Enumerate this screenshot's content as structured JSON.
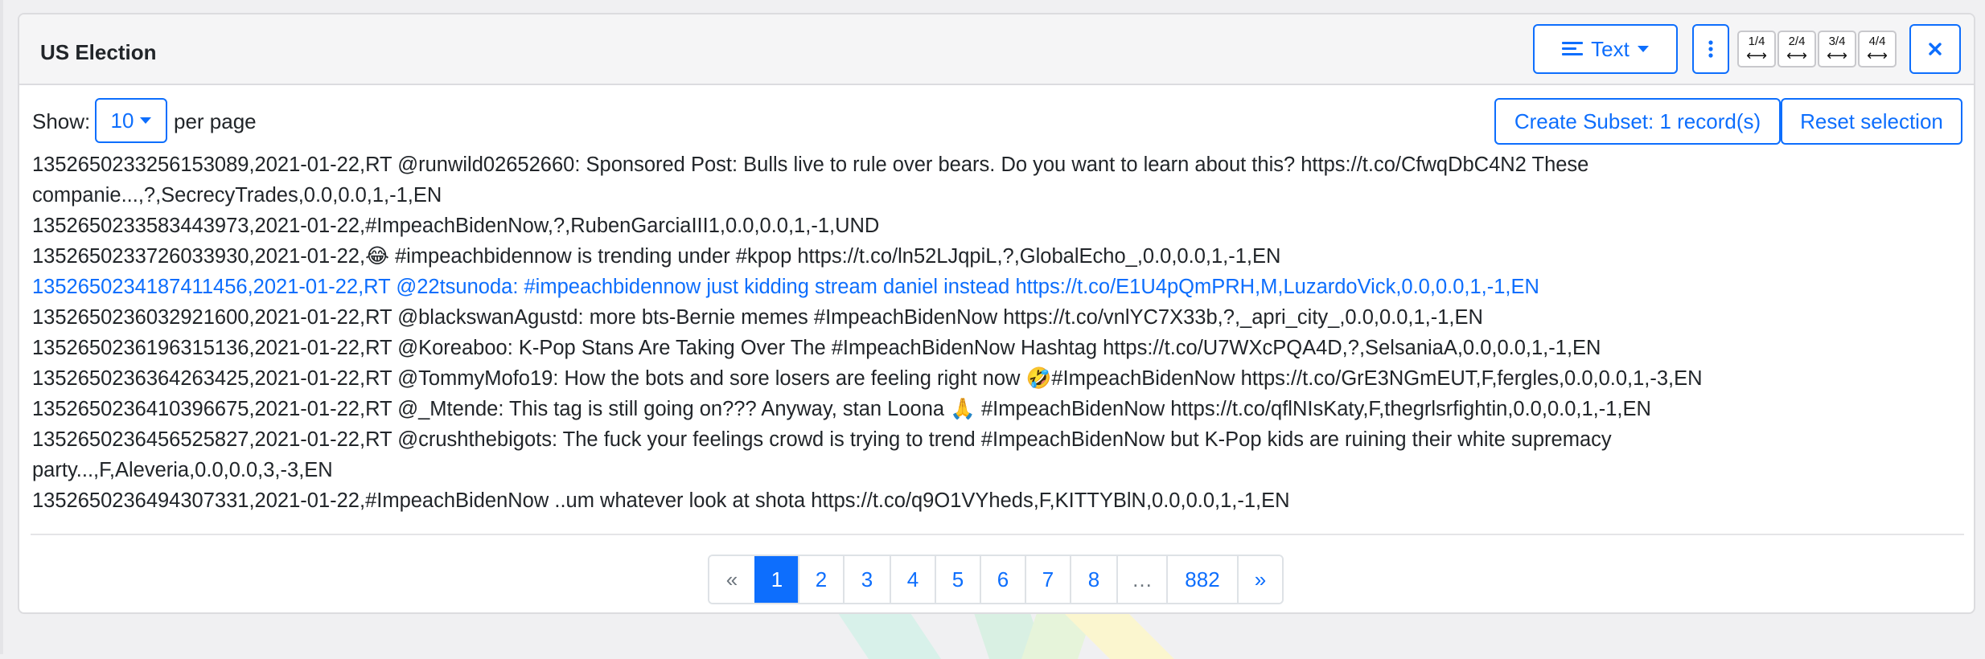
{
  "panel": {
    "title": "US Election",
    "view_button": {
      "label": "Text",
      "icon": "align-left-icon"
    },
    "more_icon": "vertical-dots-icon",
    "width_options": [
      "1/4",
      "2/4",
      "3/4",
      "4/4"
    ],
    "close_icon": "close-icon"
  },
  "controls": {
    "show_label": "Show:",
    "per_page_value": "10",
    "per_page_label": "per page",
    "create_subset_label": "Create Subset: 1 record(s)",
    "reset_selection_label": "Reset selection"
  },
  "records": [
    {
      "text": "1352650233256153089,2021-01-22,RT @runwild02652660: Sponsored Post: Bulls live to rule over bears. Do you want to learn about this? https://t.co/CfwqDbC4N2 These companie...,?,SecrecyTrades,0.0,0.0,1,-1,EN",
      "selected": false
    },
    {
      "text": "1352650233583443973,2021-01-22,#ImpeachBidenNow,?,RubenGarciaIII1,0.0,0.0,1,-1,UND",
      "selected": false
    },
    {
      "text": "1352650233726033930,2021-01-22,😂 #impeachbidennow is trending under #kpop https://t.co/ln52LJqpiL,?,GlobalEcho_,0.0,0.0,1,-1,EN",
      "selected": false
    },
    {
      "text": "1352650234187411456,2021-01-22,RT @22tsunoda: #impeachbidennow just kidding stream daniel instead https://t.co/E1U4pQmPRH,M,LuzardoVick,0.0,0.0,1,-1,EN",
      "selected": true
    },
    {
      "text": "1352650236032921600,2021-01-22,RT @blackswanAgustd: more bts-Bernie memes #ImpeachBidenNow https://t.co/vnlYC7X33b,?,_apri_city_,0.0,0.0,1,-1,EN",
      "selected": false
    },
    {
      "text": "1352650236196315136,2021-01-22,RT @Koreaboo: K-Pop Stans Are Taking Over The #ImpeachBidenNow Hashtag https://t.co/U7WXcPQA4D,?,SelsaniaA,0.0,0.0,1,-1,EN",
      "selected": false
    },
    {
      "text": "1352650236364263425,2021-01-22,RT @TommyMofo19: How the bots and sore losers are feeling right now 🤣#ImpeachBidenNow https://t.co/GrE3NGmEUT,F,fergles,0.0,0.0,1,-3,EN",
      "selected": false
    },
    {
      "text": "1352650236410396675,2021-01-22,RT @_Mtende: This tag is still going on??? Anyway, stan Loona 🙏 #ImpeachBidenNow https://t.co/qflNIsKaty,F,thegrlsrfightin,0.0,0.0,1,-1,EN",
      "selected": false
    },
    {
      "text": "1352650236456525827,2021-01-22,RT @crushthebigots: The fuck your feelings crowd is trying to trend #ImpeachBidenNow but K-Pop kids are ruining their white supremacy party...,F,Aleveria,0.0,0.0,3,-3,EN",
      "selected": false
    },
    {
      "text": "1352650236494307331,2021-01-22,#ImpeachBidenNow ..um whatever look at shota https://t.co/q9O1VYheds,F,KITTYBlN,0.0,0.0,1,-1,EN",
      "selected": false
    }
  ],
  "pagination": {
    "prev": "«",
    "pages": [
      "1",
      "2",
      "3",
      "4",
      "5",
      "6",
      "7",
      "8",
      "…",
      "882"
    ],
    "current": "1",
    "next": "»"
  },
  "colors": {
    "accent": "#0d6efd",
    "text": "#212529",
    "border": "#dcdcdf"
  }
}
